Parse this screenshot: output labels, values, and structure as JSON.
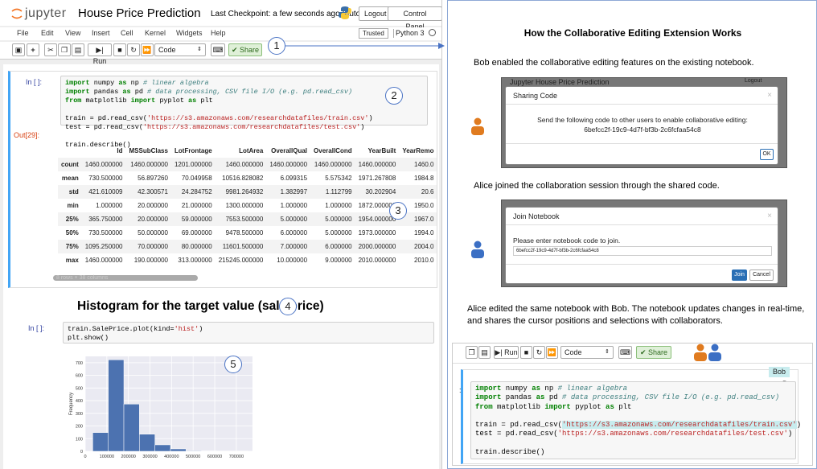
{
  "header": {
    "logo_text": "jupyter",
    "notebook_title": "House Price Prediction",
    "checkpoint": "Last Checkpoint: a few seconds ago  (autosaved)",
    "logout_label": "Logout",
    "control_panel_label": "Control Panel"
  },
  "menubar": {
    "items": [
      "File",
      "Edit",
      "View",
      "Insert",
      "Cell",
      "Kernel",
      "Widgets",
      "Help"
    ],
    "trusted_label": "Trusted",
    "kernel_label": "Python 3"
  },
  "toolbar": {
    "run_label": "Run",
    "cell_type": "Code",
    "share_label": "Share"
  },
  "callouts": [
    "1",
    "2",
    "3",
    "4",
    "5"
  ],
  "cells": {
    "prompt_in": "In [ ]:",
    "prompt_out": "Out[29]:",
    "code1": [
      "import numpy as np # linear algebra",
      "import pandas as pd # data processing, CSV file I/O (e.g. pd.read_csv)",
      "from matplotlib import pyplot as plt",
      "",
      "train = pd.read_csv('https://s3.amazonaws.com/researchdatafiles/train.csv')",
      "test = pd.read_csv('https://s3.amazonaws.com/researchdatafiles/test.csv')",
      "",
      "train.describe()"
    ],
    "table": {
      "columns": [
        "",
        "Id",
        "MSSubClass",
        "LotFrontage",
        "LotArea",
        "OverallQual",
        "OverallCond",
        "YearBuilt",
        "YearRemo"
      ],
      "rows": [
        [
          "count",
          "1460.000000",
          "1460.000000",
          "1201.000000",
          "1460.000000",
          "1460.000000",
          "1460.000000",
          "1460.000000",
          "1460.0"
        ],
        [
          "mean",
          "730.500000",
          "56.897260",
          "70.049958",
          "10516.828082",
          "6.099315",
          "5.575342",
          "1971.267808",
          "1984.8"
        ],
        [
          "std",
          "421.610009",
          "42.300571",
          "24.284752",
          "9981.264932",
          "1.382997",
          "1.112799",
          "30.202904",
          "20.6"
        ],
        [
          "min",
          "1.000000",
          "20.000000",
          "21.000000",
          "1300.000000",
          "1.000000",
          "1.000000",
          "1872.000000",
          "1950.0"
        ],
        [
          "25%",
          "365.750000",
          "20.000000",
          "59.000000",
          "7553.500000",
          "5.000000",
          "5.000000",
          "1954.000000",
          "1967.0"
        ],
        [
          "50%",
          "730.500000",
          "50.000000",
          "69.000000",
          "9478.500000",
          "6.000000",
          "5.000000",
          "1973.000000",
          "1994.0"
        ],
        [
          "75%",
          "1095.250000",
          "70.000000",
          "80.000000",
          "11601.500000",
          "7.000000",
          "6.000000",
          "2000.000000",
          "2004.0"
        ],
        [
          "max",
          "1460.000000",
          "190.000000",
          "313.000000",
          "215245.000000",
          "10.000000",
          "9.000000",
          "2010.000000",
          "2010.0"
        ]
      ],
      "footer_note": "8 rows × 38 columns"
    },
    "heading": "Histogram for the target value (sale price)",
    "code2": [
      "train.SalePrice.plot(kind='hist')",
      "plt.show()"
    ]
  },
  "chart_data": {
    "type": "bar",
    "title": "",
    "ylabel": "Frequency",
    "xlabel": "",
    "x_ticks": [
      "0",
      "100000",
      "200000",
      "300000",
      "400000",
      "500000",
      "600000",
      "700000"
    ],
    "y_ticks": [
      "0",
      "100",
      "200",
      "300",
      "400",
      "500",
      "600",
      "700"
    ],
    "xlim": [
      0,
      775000
    ],
    "ylim": [
      0,
      750
    ],
    "bin_edges": [
      34900,
      106910,
      178920,
      250930,
      322940,
      394950,
      466960,
      538970,
      610980,
      682990,
      755000
    ],
    "values": [
      148,
      723,
      373,
      135,
      51,
      19,
      4,
      3,
      2,
      2
    ],
    "bar_color": "#4c72b0"
  },
  "right": {
    "title": "How the Collaborative Editing Extension Works",
    "step1": "Bob enabled the collaborative editing features on the existing notebook.",
    "dlg1": {
      "bg_title": "Jupyter  House Price Prediction",
      "bg_logout": "Logout",
      "title": "Sharing Code",
      "message": "Send the following code to other users to enable collaborative editing:",
      "code": "6befcc2f-19c9-4d7f-bf3b-2c6fcfaa54c8",
      "ok_label": "OK"
    },
    "step2": "Alice joined the collaboration session through the shared code.",
    "dlg2": {
      "title": "Join Notebook",
      "message": "Please enter notebook code to join.",
      "input_value": "6befcc2f-19c9-4d7f-bf3b-2c6fcfaa54c8",
      "join_label": "Join",
      "cancel_label": "Cancel"
    },
    "step3": "Alice edited the same notebook with Bob. The notebook updates changes in real-time, and shares the cursor positions and selections with collaborators.",
    "collab": {
      "run_label": "Run",
      "cell_type": "Code",
      "share_label": "Share",
      "bob_label": "Bob",
      "cursor_label": "B",
      "code": [
        "import numpy as np # linear algebra",
        "import pandas as pd # data processing, CSV file I/O (e.g. pd.read_csv)",
        "from matplotlib import pyplot as plt",
        "",
        "train = pd.read_csv('https://s3.amazonaws.com/researchdatafiles/train.csv')",
        "test = pd.read_csv('https://s3.amazonaws.com/researchdatafiles/test.csv')",
        "",
        "train.describe()"
      ]
    },
    "bob_color": "#e07b1f",
    "alice_color": "#3b6fc4"
  }
}
